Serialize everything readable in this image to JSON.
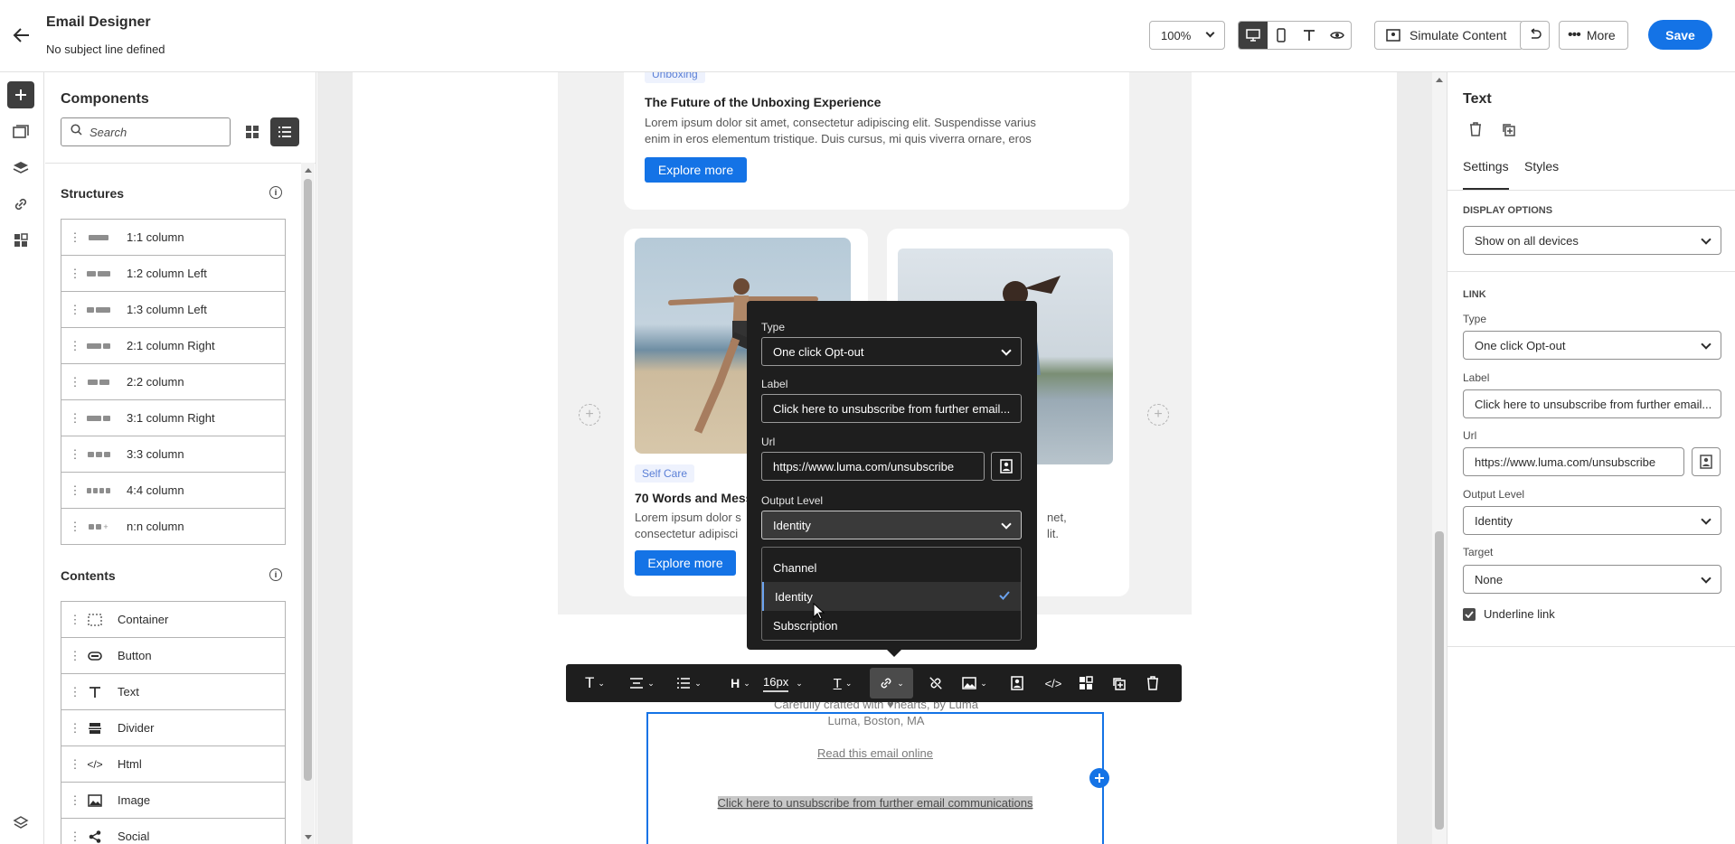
{
  "header": {
    "title": "Email Designer",
    "subtitle": "No subject line defined",
    "zoom": "100%",
    "simulate_label": "Simulate Content",
    "more_label": "More",
    "save_label": "Save"
  },
  "left_panel": {
    "title": "Components",
    "search_placeholder": "Search",
    "structures_title": "Structures",
    "structures": [
      "1:1 column",
      "1:2 column Left",
      "1:3 column Left",
      "2:1 column Right",
      "2:2 column",
      "3:1 column Right",
      "3:3 column",
      "4:4 column",
      "n:n column"
    ],
    "contents_title": "Contents",
    "contents": [
      "Container",
      "Button",
      "Text",
      "Divider",
      "Html",
      "Image",
      "Social"
    ]
  },
  "canvas": {
    "article1": {
      "tag": "Unboxing",
      "title": "The Future of the Unboxing Experience",
      "body_line1": "Lorem ipsum dolor sit amet, consectetur adipiscing elit. Suspendisse varius",
      "body_line2": "enim in eros elementum tristique. Duis cursus, mi quis viverra ornare, eros",
      "button": "Explore more"
    },
    "article2": {
      "tag": "Self Care",
      "title": "70 Words and Mess",
      "body_line1": "Lorem ipsum dolor s",
      "body_line2": "consectetur adipisci",
      "button": "Explore more"
    },
    "article3": {
      "body_line1": "net,",
      "body_line2": "lit."
    },
    "footer": {
      "crafted": "Carefully crafted with ♥hearts, by Luma",
      "address": "Luma, Boston, MA",
      "read_online": "Read this email online",
      "unsubscribe": "Click here to unsubscribe from further email communications"
    }
  },
  "popup": {
    "type_label": "Type",
    "type_value": "One click Opt-out",
    "label_label": "Label",
    "label_value": "Click here to unsubscribe from further email...",
    "url_label": "Url",
    "url_value": "https://www.luma.com/unsubscribe",
    "output_label": "Output Level",
    "output_value": "Identity",
    "options": [
      "Channel",
      "Identity",
      "Subscription"
    ],
    "selected_option": "Identity"
  },
  "toolbar": {
    "heading": "H",
    "font_size": "16px"
  },
  "right_panel": {
    "title": "Text",
    "tab_settings": "Settings",
    "tab_styles": "Styles",
    "display_options_title": "DISPLAY OPTIONS",
    "display_value": "Show on all devices",
    "link_title": "LINK",
    "type_label": "Type",
    "type_value": "One click Opt-out",
    "label_label": "Label",
    "label_value": "Click here to unsubscribe from further email...",
    "url_label": "Url",
    "url_value": "https://www.luma.com/unsubscribe",
    "output_label": "Output Level",
    "output_value": "Identity",
    "target_label": "Target",
    "target_value": "None",
    "underline_label": "Underline link"
  },
  "colors": {
    "accent": "#1473e6",
    "dark": "#1e1e1e"
  }
}
